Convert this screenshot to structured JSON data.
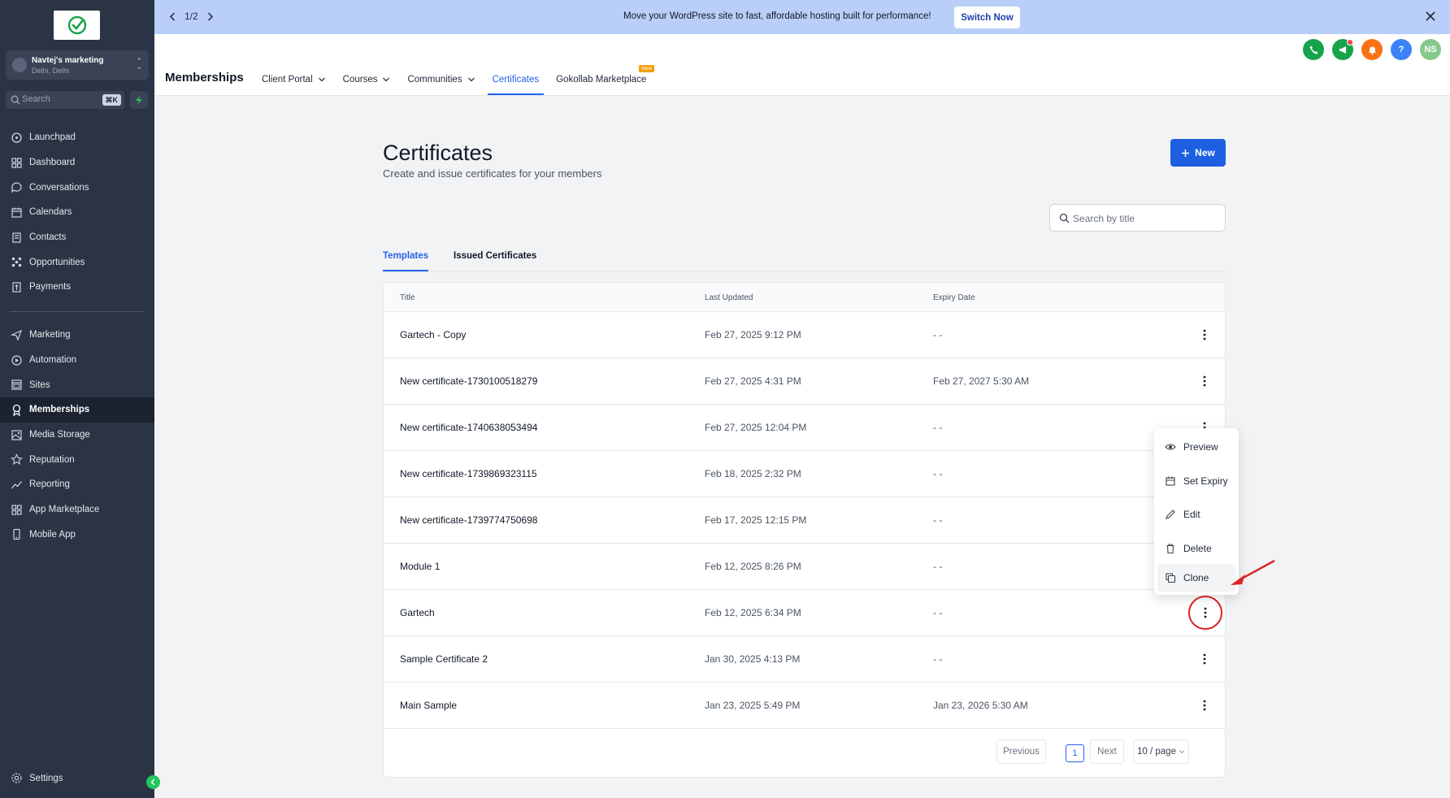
{
  "sidebar": {
    "account_name": "Navtej's marketing",
    "account_location": "Delhi, Delhi",
    "search_placeholder": "Search",
    "search_shortcut": "⌘K",
    "items_top": [
      {
        "label": "Launchpad",
        "icon": "rocket-icon"
      },
      {
        "label": "Dashboard",
        "icon": "grid-icon"
      },
      {
        "label": "Conversations",
        "icon": "chat-icon"
      },
      {
        "label": "Calendars",
        "icon": "calendar-icon"
      },
      {
        "label": "Contacts",
        "icon": "contacts-icon"
      },
      {
        "label": "Opportunities",
        "icon": "opportunities-icon"
      },
      {
        "label": "Payments",
        "icon": "payments-icon"
      }
    ],
    "items_bottom": [
      {
        "label": "Marketing",
        "icon": "send-icon"
      },
      {
        "label": "Automation",
        "icon": "automation-icon"
      },
      {
        "label": "Sites",
        "icon": "sites-icon"
      },
      {
        "label": "Memberships",
        "icon": "award-icon",
        "active": true
      },
      {
        "label": "Media Storage",
        "icon": "image-icon"
      },
      {
        "label": "Reputation",
        "icon": "star-icon"
      },
      {
        "label": "Reporting",
        "icon": "chart-icon"
      },
      {
        "label": "App Marketplace",
        "icon": "apps-icon"
      },
      {
        "label": "Mobile App",
        "icon": "phone-icon"
      }
    ],
    "settings_label": "Settings"
  },
  "banner": {
    "pager": "1/2",
    "message": "Move your WordPress site to fast, affordable hosting built for performance!",
    "button": "Switch Now"
  },
  "header": {
    "title": "Memberships",
    "tabs": [
      {
        "label": "Client Portal",
        "dropdown": true
      },
      {
        "label": "Courses",
        "dropdown": true
      },
      {
        "label": "Communities",
        "dropdown": true
      },
      {
        "label": "Certificates",
        "active": true
      },
      {
        "label": "Gokollab Marketplace",
        "badge": "New"
      }
    ],
    "avatar_initials": "NS",
    "help_label": "?"
  },
  "page": {
    "title": "Certificates",
    "subtitle": "Create and issue certificates for your members",
    "new_button": "New",
    "search_placeholder": "Search by title",
    "tabs": [
      "Templates",
      "Issued Certificates"
    ]
  },
  "table": {
    "columns": [
      "Title",
      "Last Updated",
      "Expiry Date"
    ],
    "rows": [
      {
        "title": "Gartech - Copy",
        "updated": "Feb 27, 2025 9:12 PM",
        "expiry": "- -"
      },
      {
        "title": "New certificate-1730100518279",
        "updated": "Feb 27, 2025 4:31 PM",
        "expiry": "Feb 27, 2027 5:30 AM"
      },
      {
        "title": "New certificate-1740638053494",
        "updated": "Feb 27, 2025 12:04 PM",
        "expiry": "- -"
      },
      {
        "title": "New certificate-1739869323115",
        "updated": "Feb 18, 2025 2:32 PM",
        "expiry": "- -"
      },
      {
        "title": "New certificate-1739774750698",
        "updated": "Feb 17, 2025 12:15 PM",
        "expiry": "- -"
      },
      {
        "title": "Module 1",
        "updated": "Feb 12, 2025 8:26 PM",
        "expiry": "- -"
      },
      {
        "title": "Gartech",
        "updated": "Feb 12, 2025 6:34 PM",
        "expiry": "- -"
      },
      {
        "title": "Sample Certificate 2",
        "updated": "Jan 30, 2025 4:13 PM",
        "expiry": "- -"
      },
      {
        "title": "Main Sample",
        "updated": "Jan 23, 2025 5:49 PM",
        "expiry": "Jan 23, 2026 5:30 AM"
      }
    ]
  },
  "pagination": {
    "previous": "Previous",
    "current": "1",
    "next": "Next",
    "page_size": "10 / page"
  },
  "menu": {
    "items": [
      {
        "label": "Preview",
        "icon": "eye-icon"
      },
      {
        "label": "Set Expiry",
        "icon": "calendar-icon"
      },
      {
        "label": "Edit",
        "icon": "pencil-icon"
      },
      {
        "label": "Delete",
        "icon": "trash-icon"
      },
      {
        "label": "Clone",
        "icon": "copy-icon"
      }
    ]
  },
  "colors": {
    "sidebar_bg": "#2b3445",
    "banner_bg": "#b9cff9",
    "accent": "#2563eb",
    "primary_button": "#1d5fe0",
    "annotation_red": "#dc2626"
  }
}
